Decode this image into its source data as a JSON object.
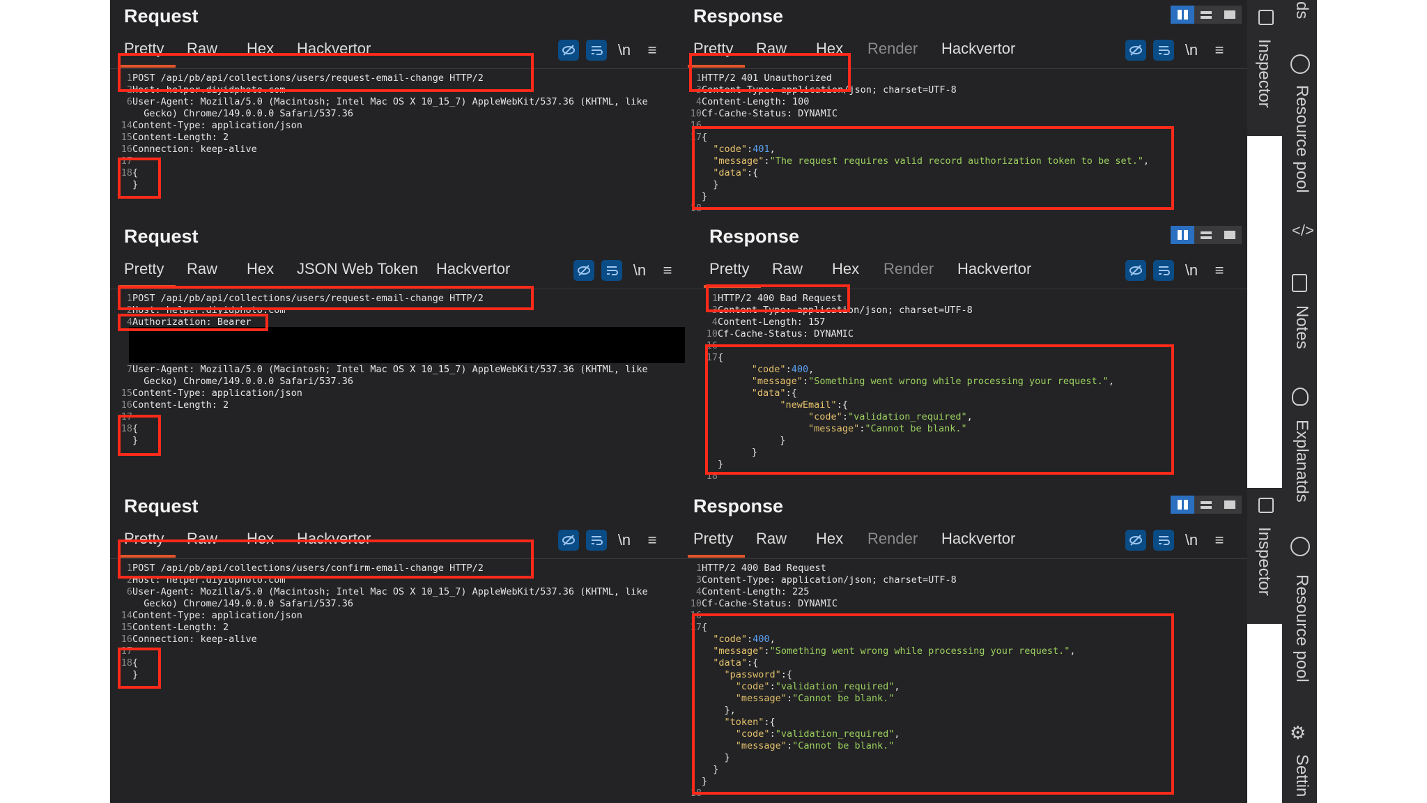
{
  "panels": {
    "req1": {
      "title": "Request",
      "tabs": [
        "Pretty",
        "Raw",
        "Hex",
        "Hackvertor"
      ],
      "lines": [
        {
          "n": "1",
          "t": "POST /api/pb/api/collections/users/request-email-change HTTP/2"
        },
        {
          "n": "2",
          "t": "Host: helper.diyidphoto.com"
        },
        {
          "n": "6",
          "t": "User-Agent: Mozilla/5.0 (Macintosh; Intel Mac OS X 10_15_7) AppleWebKit/537.36 (KHTML, like"
        },
        {
          "n": "",
          "t": "  Gecko) Chrome/149.0.0.0 Safari/537.36"
        },
        {
          "n": "14",
          "t": "Content-Type: application/json"
        },
        {
          "n": "15",
          "t": "Content-Length: 2"
        },
        {
          "n": "16",
          "t": "Connection: keep-alive"
        },
        {
          "n": "17",
          "t": ""
        },
        {
          "n": "18",
          "t": "{"
        },
        {
          "n": "",
          "t": "}"
        }
      ]
    },
    "resp1": {
      "title": "Response",
      "tabs": [
        "Pretty",
        "Raw",
        "Hex",
        "Render",
        "Hackvertor"
      ],
      "lines": [
        {
          "n": "1",
          "t": "HTTP/2 401 Unauthorized"
        },
        {
          "n": "3",
          "t": "Content-Type: application/json; charset=UTF-8"
        },
        {
          "n": "4",
          "t": "Content-Length: 100"
        },
        {
          "n": "10",
          "t": "Cf-Cache-Status: DYNAMIC"
        },
        {
          "n": "16",
          "t": ""
        },
        {
          "n": "17",
          "t": "{"
        },
        {
          "n": "",
          "t": "  \"code\":401,"
        },
        {
          "n": "",
          "t": "  \"message\":\"The request requires valid record authorization token to be set.\","
        },
        {
          "n": "",
          "t": "  \"data\":{"
        },
        {
          "n": "",
          "t": "  }"
        },
        {
          "n": "",
          "t": "}"
        },
        {
          "n": "18",
          "t": ""
        }
      ]
    },
    "req2": {
      "title": "Request",
      "tabs": [
        "Pretty",
        "Raw",
        "Hex",
        "JSON Web Token",
        "Hackvertor"
      ],
      "lines": [
        {
          "n": "1",
          "t": "POST /api/pb/api/collections/users/request-email-change HTTP/2"
        },
        {
          "n": "2",
          "t": "Host: helper.diyidphoto.com"
        },
        {
          "n": "4",
          "t": "Authorization: Bearer"
        },
        {
          "n": "",
          "t": ""
        },
        {
          "n": "",
          "t": ""
        },
        {
          "n": "",
          "t": ""
        },
        {
          "n": "7",
          "t": "User-Agent: Mozilla/5.0 (Macintosh; Intel Mac OS X 10_15_7) AppleWebKit/537.36 (KHTML, like"
        },
        {
          "n": "",
          "t": "  Gecko) Chrome/149.0.0.0 Safari/537.36"
        },
        {
          "n": "15",
          "t": "Content-Type: application/json"
        },
        {
          "n": "16",
          "t": "Content-Length: 2"
        },
        {
          "n": "17",
          "t": ""
        },
        {
          "n": "18",
          "t": "{"
        },
        {
          "n": "",
          "t": "}"
        }
      ]
    },
    "resp2": {
      "title": "Response",
      "tabs": [
        "Pretty",
        "Raw",
        "Hex",
        "Render",
        "Hackvertor"
      ],
      "lines": [
        {
          "n": "1",
          "t": "HTTP/2 400 Bad Request"
        },
        {
          "n": "3",
          "t": "Content-Type: application/json; charset=UTF-8"
        },
        {
          "n": "4",
          "t": "Content-Length: 157"
        },
        {
          "n": "10",
          "t": "Cf-Cache-Status: DYNAMIC"
        },
        {
          "n": "16",
          "t": ""
        },
        {
          "n": "17",
          "t": "{"
        },
        {
          "n": "",
          "t": "      \"code\":400,"
        },
        {
          "n": "",
          "t": "      \"message\":\"Something went wrong while processing your request.\","
        },
        {
          "n": "",
          "t": "      \"data\":{"
        },
        {
          "n": "",
          "t": "           \"newEmail\":{"
        },
        {
          "n": "",
          "t": "                \"code\":\"validation_required\","
        },
        {
          "n": "",
          "t": "                \"message\":\"Cannot be blank.\""
        },
        {
          "n": "",
          "t": "           }"
        },
        {
          "n": "",
          "t": "      }"
        },
        {
          "n": "",
          "t": "}"
        },
        {
          "n": "18",
          "t": ""
        }
      ]
    },
    "req3": {
      "title": "Request",
      "tabs": [
        "Pretty",
        "Raw",
        "Hex",
        "Hackvertor"
      ],
      "lines": [
        {
          "n": "1",
          "t": "POST /api/pb/api/collections/users/confirm-email-change HTTP/2"
        },
        {
          "n": "2",
          "t": "Host: helper.diyidphoto.com"
        },
        {
          "n": "6",
          "t": "User-Agent: Mozilla/5.0 (Macintosh; Intel Mac OS X 10_15_7) AppleWebKit/537.36 (KHTML, like"
        },
        {
          "n": "",
          "t": "  Gecko) Chrome/149.0.0.0 Safari/537.36"
        },
        {
          "n": "14",
          "t": "Content-Type: application/json"
        },
        {
          "n": "15",
          "t": "Content-Length: 2"
        },
        {
          "n": "16",
          "t": "Connection: keep-alive"
        },
        {
          "n": "17",
          "t": ""
        },
        {
          "n": "18",
          "t": "{"
        },
        {
          "n": "",
          "t": "}"
        }
      ]
    },
    "resp3": {
      "title": "Response",
      "tabs": [
        "Pretty",
        "Raw",
        "Hex",
        "Render",
        "Hackvertor"
      ],
      "lines": [
        {
          "n": "1",
          "t": "HTTP/2 400 Bad Request"
        },
        {
          "n": "3",
          "t": "Content-Type: application/json; charset=UTF-8"
        },
        {
          "n": "4",
          "t": "Content-Length: 225"
        },
        {
          "n": "10",
          "t": "Cf-Cache-Status: DYNAMIC"
        },
        {
          "n": "16",
          "t": ""
        },
        {
          "n": "17",
          "t": "{"
        },
        {
          "n": "",
          "t": "  \"code\":400,"
        },
        {
          "n": "",
          "t": "  \"message\":\"Something went wrong while processing your request.\","
        },
        {
          "n": "",
          "t": "  \"data\":{"
        },
        {
          "n": "",
          "t": "    \"password\":{"
        },
        {
          "n": "",
          "t": "      \"code\":\"validation_required\","
        },
        {
          "n": "",
          "t": "      \"message\":\"Cannot be blank.\""
        },
        {
          "n": "",
          "t": "    },"
        },
        {
          "n": "",
          "t": "    \"token\":{"
        },
        {
          "n": "",
          "t": "      \"code\":\"validation_required\","
        },
        {
          "n": "",
          "t": "      \"message\":\"Cannot be blank.\""
        },
        {
          "n": "",
          "t": "    }"
        },
        {
          "n": "",
          "t": "  }"
        },
        {
          "n": "",
          "t": "}"
        },
        {
          "n": "18",
          "t": ""
        }
      ]
    }
  },
  "toolbar": {
    "newline_label": "\\n"
  },
  "sidebar": {
    "items": [
      "ds",
      "Resource pool",
      "Notes",
      "Explanatds",
      "Settin"
    ],
    "inspector": "Inspector"
  },
  "colors": {
    "background": "#232325",
    "highlight_box": "#ff2a1a",
    "accent_tab": "#e0552b",
    "button_blue": "#0a4c86"
  }
}
